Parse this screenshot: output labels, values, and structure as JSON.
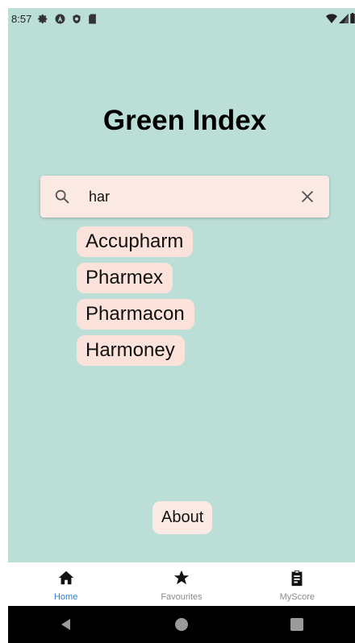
{
  "status_bar": {
    "time": "8:57",
    "left_icons": [
      "settings-icon",
      "a-badge-icon",
      "shield-icon",
      "sd-card-icon"
    ],
    "right_icons": [
      "wifi-icon",
      "signal-icon",
      "battery-icon"
    ]
  },
  "page": {
    "title": "Green Index",
    "background_color": "#bbdfd7"
  },
  "search": {
    "value": "har",
    "placeholder": ""
  },
  "results": [
    {
      "label": "Accupharm"
    },
    {
      "label": "Pharmex"
    },
    {
      "label": "Pharmacon"
    },
    {
      "label": "Harmoney"
    }
  ],
  "about_button": {
    "label": "About"
  },
  "bottom_nav": {
    "items": [
      {
        "label": "Home",
        "icon": "home-icon",
        "active": true
      },
      {
        "label": "Favourites",
        "icon": "star-icon",
        "active": false
      },
      {
        "label": "MyScore",
        "icon": "clipboard-icon",
        "active": false
      }
    ],
    "active_color": "#2c7fd6"
  },
  "system_nav": {
    "buttons": [
      "back-icon",
      "home-circle-icon",
      "recents-icon"
    ]
  }
}
